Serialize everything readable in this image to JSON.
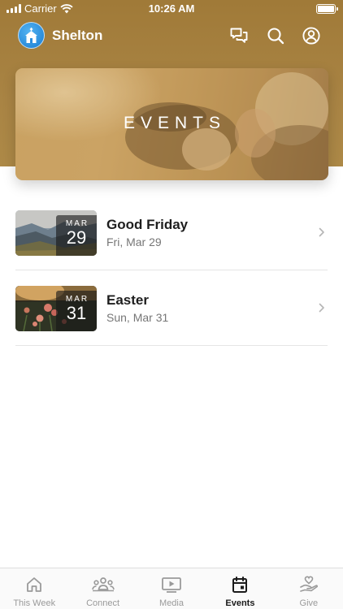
{
  "status_bar": {
    "carrier": "Carrier",
    "time": "10:26 AM"
  },
  "header": {
    "church_name": "Shelton"
  },
  "banner": {
    "title": "EVENTS"
  },
  "events": [
    {
      "month": "MAR",
      "day": "29",
      "title": "Good Friday",
      "date_text": "Fri, Mar 29"
    },
    {
      "month": "MAR",
      "day": "31",
      "title": "Easter",
      "date_text": "Sun, Mar 31"
    }
  ],
  "tabs": [
    {
      "label": "This Week",
      "icon": "home-icon",
      "active": false
    },
    {
      "label": "Connect",
      "icon": "people-icon",
      "active": false
    },
    {
      "label": "Media",
      "icon": "play-icon",
      "active": false
    },
    {
      "label": "Events",
      "icon": "calendar-icon",
      "active": true
    },
    {
      "label": "Give",
      "icon": "hand-heart-icon",
      "active": false
    }
  ],
  "colors": {
    "header_brown": "#a98444",
    "active_tab": "#1a1a1a",
    "inactive_tab": "#9a9a9a"
  }
}
